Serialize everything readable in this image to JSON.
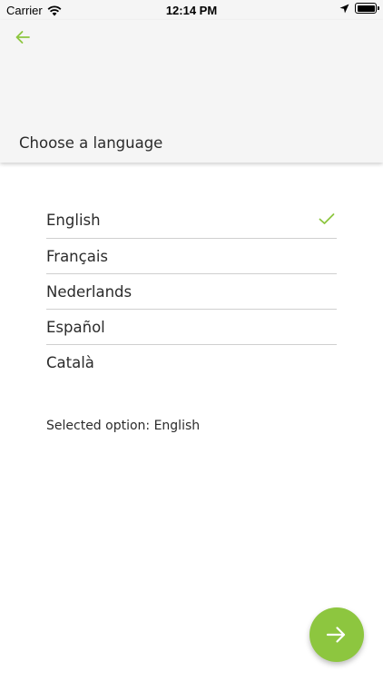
{
  "status_bar": {
    "carrier": "Carrier",
    "time": "12:14 PM",
    "icons": [
      "wifi-icon",
      "location-arrow-icon",
      "battery-icon"
    ]
  },
  "header": {
    "back_icon": "arrow-left-icon",
    "title": "Choose a language"
  },
  "languages": [
    {
      "label": "English",
      "selected": true
    },
    {
      "label": "Français",
      "selected": false
    },
    {
      "label": "Nederlands",
      "selected": false
    },
    {
      "label": "Español",
      "selected": false
    },
    {
      "label": "Català",
      "selected": false
    }
  ],
  "selection": {
    "text": "Selected option: English"
  },
  "next_button": {
    "icon": "arrow-right-icon"
  },
  "colors": {
    "accent": "#8dc63f",
    "header_bg": "#f5f5f5",
    "divider": "#cfcfcf",
    "text": "#2b2b2b"
  }
}
